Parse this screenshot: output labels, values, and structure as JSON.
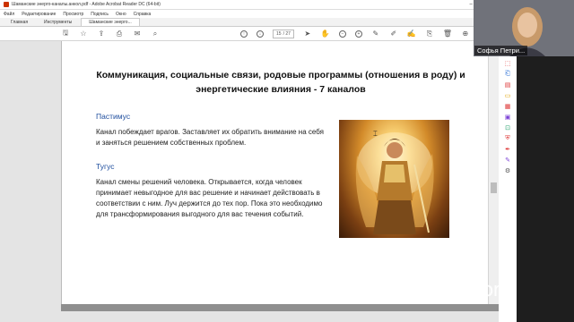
{
  "window": {
    "title": "Шаманские энерго-каналы.анкол.pdf - Adobe Acrobat Reader DC (64-bit)"
  },
  "menu": {
    "items": [
      "Файл",
      "Редактирование",
      "Просмотр",
      "Подпись",
      "Окно",
      "Справка"
    ]
  },
  "tabs": [
    {
      "label": "Главная"
    },
    {
      "label": "Инструменты"
    },
    {
      "label": "Шаманские энерго..."
    }
  ],
  "toolbar": {
    "page_current": "15",
    "page_total": "/ 27"
  },
  "slide": {
    "title": "Коммуникация, социальные связи, родовые программы (отношения в роду) и энергетические влияния - 7 каналов",
    "sections": [
      {
        "name": "Пастимус",
        "text": "Канал побеждает врагов. Заставляет их обратить внимание на себя и заняться решением собственных проблем."
      },
      {
        "name": "Тугус",
        "text": "Канал смены решений человека. Открывается, когда человек принимает невыгодное для вас решение и начинает действовать в соответствии с ним. Луч держится до тех пор. Пока это необходимо для трансформирования выгодного для вас течения событий."
      }
    ]
  },
  "participant": {
    "name": "Софья Петри..."
  },
  "zoom_logo": "zoom",
  "colors": {
    "section_name": "#1f4e9e",
    "accent": "#c30"
  }
}
